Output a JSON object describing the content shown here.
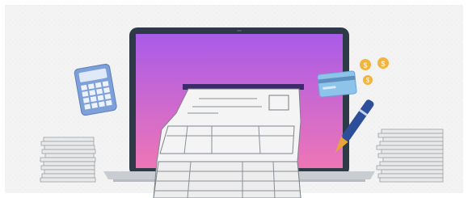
{
  "scene": {
    "description_kind": "illustration",
    "colors": {
      "background": "#f3f3f3",
      "laptop_frame": "#2f3a48",
      "screen_top": "#a95be8",
      "screen_bottom": "#ee76b6",
      "paper": "#f4f4f4",
      "paper_line": "#8a8f96",
      "calculator": "#7ea0d8",
      "card": "#8ec3ea",
      "coin": "#f2b43a",
      "pen_body": "#2d4f9a",
      "pen_tip": "#e8a33a"
    },
    "icons": [
      "calculator-icon",
      "credit-card-icon",
      "dollar-coin-icon",
      "fountain-pen-icon",
      "paper-stack-icon",
      "receipt-icon",
      "laptop-icon"
    ],
    "coin_symbol": "$"
  }
}
